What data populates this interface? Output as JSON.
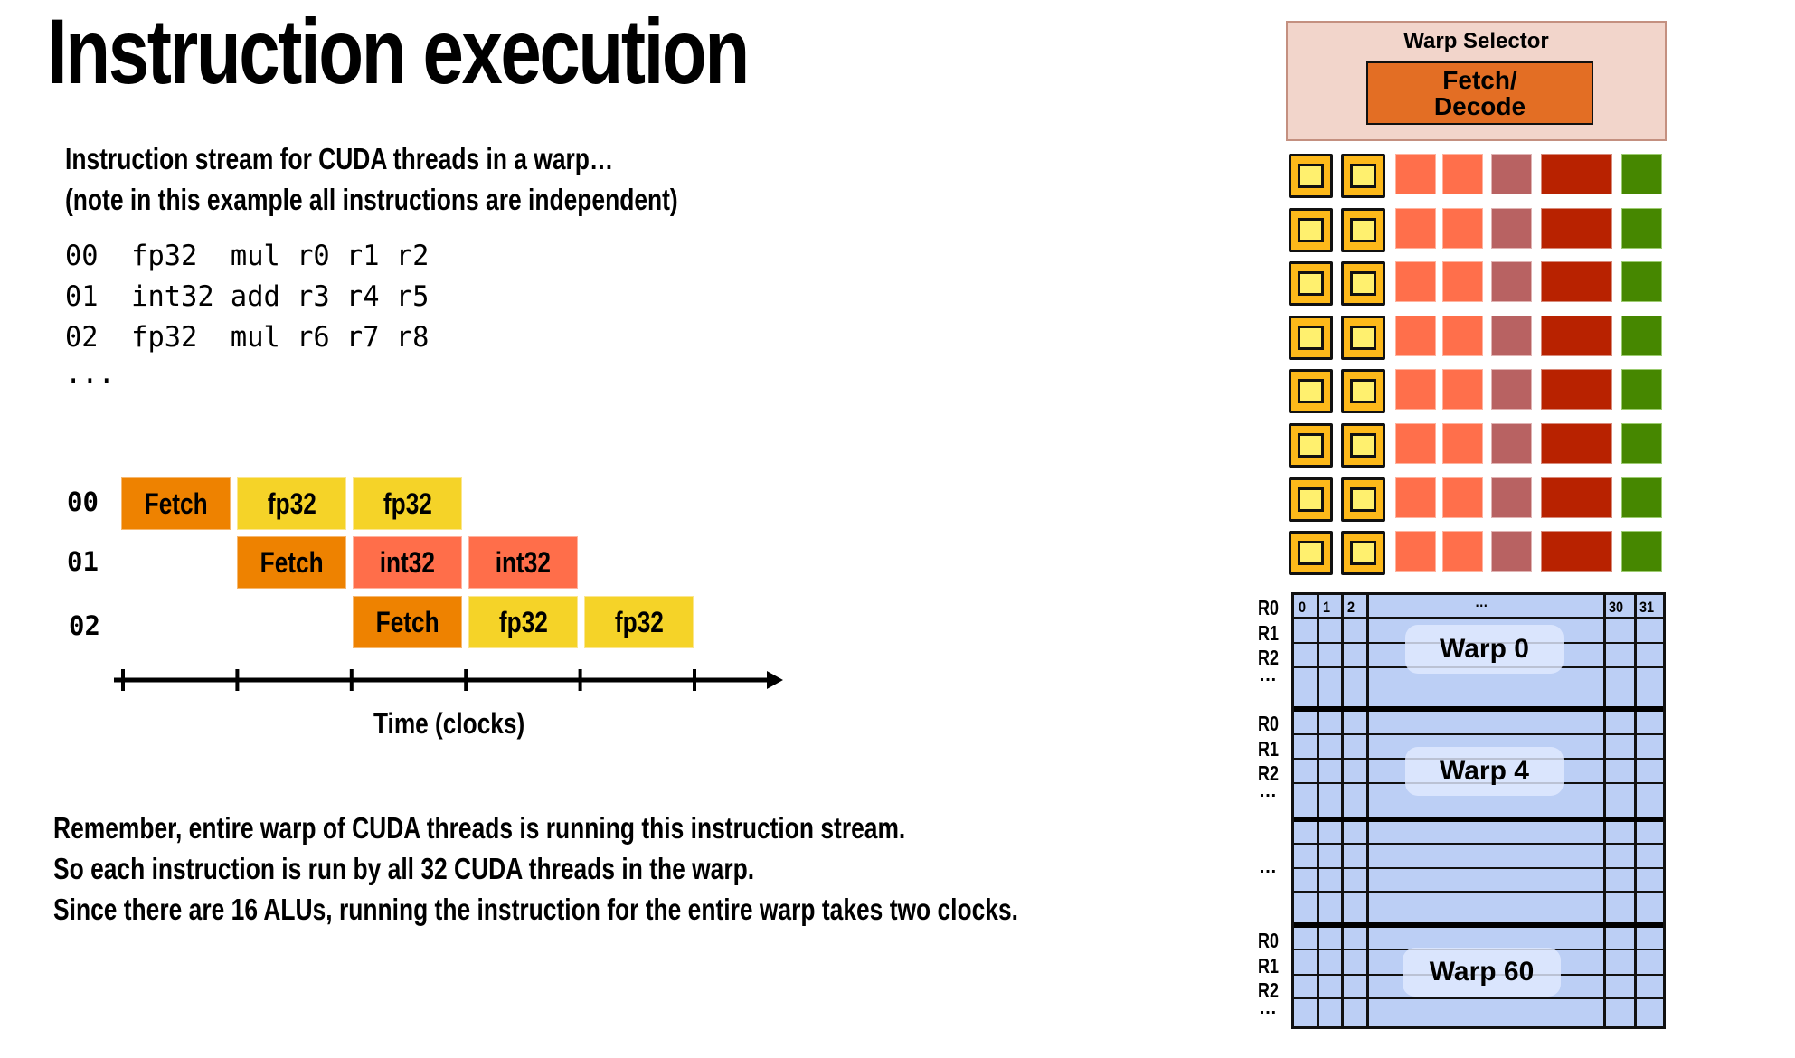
{
  "slide": {
    "title": "Instruction execution",
    "intro": [
      "Instruction stream for CUDA threads in a warp…",
      "(note in this example all instructions are independent)"
    ],
    "code_lines": [
      "00  fp32  mul r0 r1 r2",
      "01  int32 add r3 r4 r5",
      "02  fp32  mul r6 r7 r8",
      "..."
    ],
    "bottom_text": [
      "Remember, entire warp of CUDA threads is running this instruction stream.",
      "So each instruction is run by all 32 CUDA threads in the warp.",
      "Since there are 16 ALUs, running the instruction for the entire warp takes two clocks."
    ]
  },
  "timeline": {
    "axis_label": "Time (clocks)",
    "tick_count": 6,
    "rows": [
      {
        "label": "00",
        "stages": [
          {
            "name": "Fetch",
            "start": 0,
            "type": "fetch"
          },
          {
            "name": "fp32",
            "start": 1,
            "type": "fp32"
          },
          {
            "name": "fp32",
            "start": 2,
            "type": "fp32"
          }
        ]
      },
      {
        "label": "01",
        "stages": [
          {
            "name": "Fetch",
            "start": 1,
            "type": "fetch"
          },
          {
            "name": "int32",
            "start": 2,
            "type": "int32"
          },
          {
            "name": "int32",
            "start": 3,
            "type": "int32"
          }
        ]
      },
      {
        "label": "02",
        "stages": [
          {
            "name": "Fetch",
            "start": 2,
            "type": "fetch"
          },
          {
            "name": "fp32",
            "start": 3,
            "type": "fp32"
          },
          {
            "name": "fp32",
            "start": 4,
            "type": "fp32"
          }
        ]
      }
    ],
    "colors": {
      "fetch": "#ee8200",
      "fp32": "#f5d328",
      "int32": "#ff6e4a"
    }
  },
  "core": {
    "warp_selector_label": "Warp Selector",
    "fetch_decode_line1": "Fetch/",
    "fetch_decode_line2": "Decode",
    "alu_row_count": 8,
    "unit_colors": {
      "context": "#fdb91a",
      "context_inner": "#fff06e",
      "int_alu": "#ff6f4b",
      "mauve_unit": "#b86262",
      "dark_red_unit": "#b82200",
      "green_unit": "#468700"
    }
  },
  "register_file": {
    "lane_headers": [
      "0",
      "1",
      "2",
      "…",
      "30",
      "31"
    ],
    "reg_labels": [
      "R0",
      "R1",
      "R2"
    ],
    "ellipsis": "…",
    "warps": [
      "Warp 0",
      "Warp 4",
      "Warp 60"
    ],
    "fill_color": "#bccff5"
  }
}
